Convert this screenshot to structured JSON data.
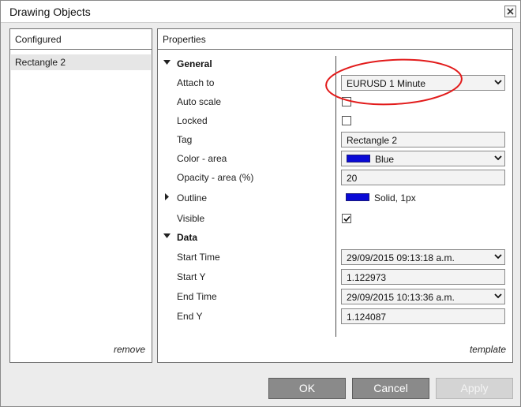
{
  "window": {
    "title": "Drawing Objects"
  },
  "configured": {
    "header": "Configured",
    "items": [
      {
        "label": "Rectangle 2",
        "selected": true
      }
    ],
    "remove_label": "remove"
  },
  "properties": {
    "header": "Properties",
    "template_label": "template",
    "general": {
      "section_label": "General",
      "attach_to": {
        "label": "Attach to",
        "value": "EURUSD 1 Minute"
      },
      "auto_scale": {
        "label": "Auto scale",
        "checked": false
      },
      "locked": {
        "label": "Locked",
        "checked": false
      },
      "tag": {
        "label": "Tag",
        "value": "Rectangle 2"
      },
      "color_area": {
        "label": "Color - area",
        "value": "Blue",
        "swatch": "#0a0ad6"
      },
      "opacity_area": {
        "label": "Opacity - area (%)",
        "value": "20"
      },
      "outline": {
        "label": "Outline",
        "value": "Solid, 1px",
        "swatch": "#0a0ad6"
      },
      "visible": {
        "label": "Visible",
        "checked": true
      }
    },
    "data": {
      "section_label": "Data",
      "start_time": {
        "label": "Start Time",
        "value": "29/09/2015 09:13:18 a.m."
      },
      "start_y": {
        "label": "Start Y",
        "value": "1.122973"
      },
      "end_time": {
        "label": "End Time",
        "value": "29/09/2015 10:13:36 a.m."
      },
      "end_y": {
        "label": "End Y",
        "value": "1.124087"
      }
    }
  },
  "buttons": {
    "ok": "OK",
    "cancel": "Cancel",
    "apply": "Apply",
    "apply_enabled": false
  },
  "colors": {
    "button_bg": "#8a8a8a",
    "annotation": "#e21b1b",
    "swatch_blue": "#0a0ad6"
  }
}
